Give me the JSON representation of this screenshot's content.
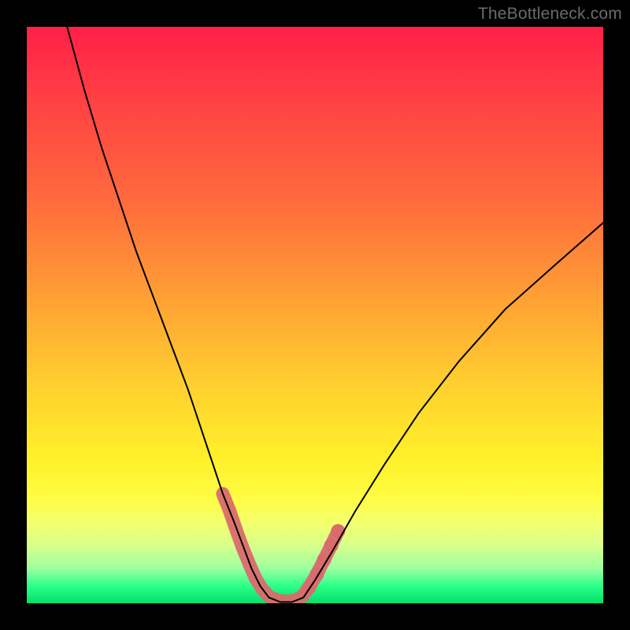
{
  "watermark": "TheBottleneck.com",
  "colors": {
    "page_bg": "#000000",
    "gradient_top": "#ff1f47",
    "gradient_mid": "#ffd22f",
    "gradient_bottom": "#03e06a",
    "curve_stroke": "#000000",
    "marker_fill": "#d96b6d"
  },
  "chart_data": {
    "type": "line",
    "title": "",
    "xlabel": "",
    "ylabel": "",
    "xlim": [
      0,
      100
    ],
    "ylim": [
      0,
      100
    ],
    "note": "Axes unlabeled in source image; values are pixel-proportional estimates on a 0–100 scale.",
    "series": [
      {
        "name": "left-curve",
        "x": [
          7,
          10,
          13,
          16,
          19,
          22,
          25,
          28,
          30,
          32,
          34,
          36,
          37.5,
          39,
          40.5,
          42
        ],
        "y": [
          100,
          89,
          79,
          70,
          61,
          53,
          45,
          37,
          31,
          25,
          19,
          14,
          10,
          6,
          3,
          1
        ]
      },
      {
        "name": "valley",
        "x": [
          42,
          44,
          46,
          48
        ],
        "y": [
          1,
          0.2,
          0.2,
          1
        ]
      },
      {
        "name": "right-curve",
        "x": [
          48,
          50,
          53,
          57,
          62,
          68,
          75,
          83,
          92,
          100
        ],
        "y": [
          1,
          4,
          9,
          16,
          24,
          33,
          42,
          51,
          59,
          66
        ]
      }
    ],
    "markers": {
      "name": "highlight-band",
      "note": "Salmon dot/segment overlay near valley bottom on both limbs",
      "points": [
        {
          "x": 34.0,
          "y": 19
        },
        {
          "x": 35.2,
          "y": 16
        },
        {
          "x": 36.4,
          "y": 12.5
        },
        {
          "x": 37.5,
          "y": 9.5
        },
        {
          "x": 38.6,
          "y": 6.8
        },
        {
          "x": 39.7,
          "y": 4.3
        },
        {
          "x": 40.8,
          "y": 2.5
        },
        {
          "x": 42.0,
          "y": 1.2
        },
        {
          "x": 43.5,
          "y": 0.5
        },
        {
          "x": 45.0,
          "y": 0.3
        },
        {
          "x": 46.5,
          "y": 0.5
        },
        {
          "x": 47.8,
          "y": 1.2
        },
        {
          "x": 49.0,
          "y": 2.8
        },
        {
          "x": 50.3,
          "y": 5.0
        },
        {
          "x": 51.6,
          "y": 7.6
        },
        {
          "x": 52.8,
          "y": 10.0
        },
        {
          "x": 54.0,
          "y": 12.5
        }
      ]
    }
  }
}
